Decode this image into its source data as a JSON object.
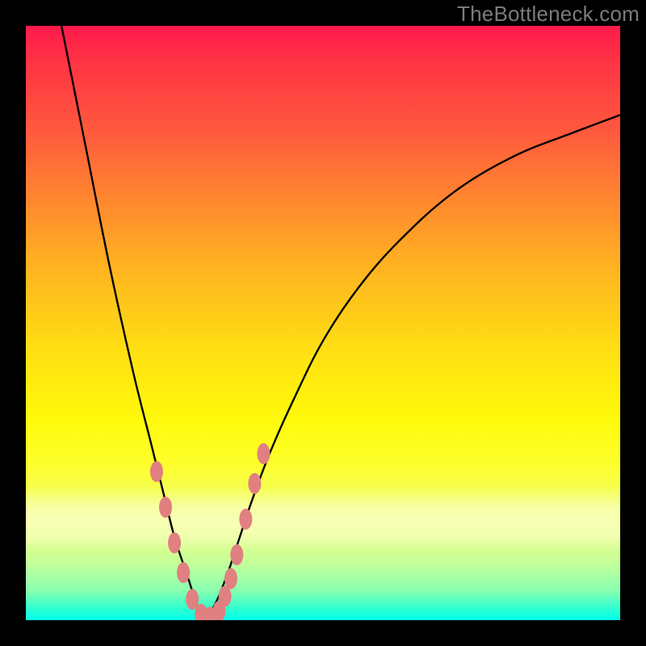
{
  "watermark": "TheBottleneck.com",
  "colors": {
    "frame": "#000000",
    "curve": "#000000",
    "marker": "#e08080",
    "watermark_text": "#7b7b7b"
  },
  "chart_data": {
    "type": "line",
    "title": "",
    "xlabel": "",
    "ylabel": "",
    "xlim": [
      0,
      100
    ],
    "ylim": [
      0,
      100
    ],
    "grid": false,
    "legend": false,
    "note": "Bottleneck-style V-curve. x is relative horizontal position (0-100), y is relative height from bottom (0-100). Minimum ~0 at x≈30; left branch rises steeply, right branch rises with decreasing slope.",
    "series": [
      {
        "name": "left_branch",
        "x": [
          6,
          10,
          14,
          18,
          21,
          23,
          25,
          27,
          29,
          30
        ],
        "y": [
          100,
          80,
          60,
          42,
          30,
          22,
          14,
          8,
          2,
          0
        ]
      },
      {
        "name": "right_branch",
        "x": [
          30,
          32,
          34,
          36,
          38,
          41,
          45,
          50,
          56,
          63,
          72,
          82,
          92,
          100
        ],
        "y": [
          0,
          3,
          8,
          14,
          20,
          28,
          37,
          47,
          56,
          64,
          72,
          78,
          82,
          85
        ]
      }
    ],
    "markers": {
      "name": "highlighted_points",
      "note": "Salmon-colored oval markers clustered near the trough on both branches.",
      "points": [
        {
          "x": 22.0,
          "y": 25
        },
        {
          "x": 23.5,
          "y": 19
        },
        {
          "x": 25.0,
          "y": 13
        },
        {
          "x": 26.5,
          "y": 8
        },
        {
          "x": 28.0,
          "y": 3.5
        },
        {
          "x": 29.5,
          "y": 1
        },
        {
          "x": 31.0,
          "y": 0.5
        },
        {
          "x": 32.5,
          "y": 1.5
        },
        {
          "x": 33.5,
          "y": 4
        },
        {
          "x": 34.5,
          "y": 7
        },
        {
          "x": 35.5,
          "y": 11
        },
        {
          "x": 37.0,
          "y": 17
        },
        {
          "x": 38.5,
          "y": 23
        },
        {
          "x": 40.0,
          "y": 28
        }
      ]
    }
  }
}
